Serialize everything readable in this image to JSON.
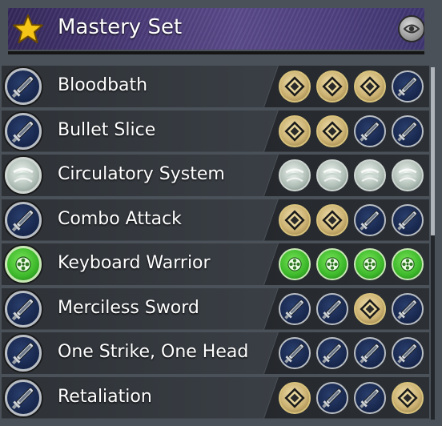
{
  "header": {
    "title": "Mastery Set",
    "icon": "star-icon",
    "toggle_icon": "eye-icon"
  },
  "colors": {
    "gold": "#cdb374",
    "blade_blue": "#1f3260",
    "green": "#3cb82a"
  },
  "rows": [
    {
      "label": "Bloodbath",
      "icon": "blade",
      "slots": [
        "gold",
        "gold",
        "gold",
        "blade"
      ]
    },
    {
      "label": "Bullet Slice",
      "icon": "blade",
      "slots": [
        "gold",
        "gold",
        "blade",
        "blade"
      ]
    },
    {
      "label": "Circulatory System",
      "icon": "silver",
      "slots": [
        "silver",
        "silver",
        "silver",
        "silver"
      ]
    },
    {
      "label": "Combo Attack",
      "icon": "blade",
      "slots": [
        "gold",
        "gold",
        "blade",
        "blade"
      ]
    },
    {
      "label": "Keyboard Warrior",
      "icon": "green",
      "slots": [
        "green",
        "green",
        "green",
        "green"
      ]
    },
    {
      "label": "Merciless Sword",
      "icon": "blade",
      "slots": [
        "blade",
        "blade",
        "gold",
        "blade"
      ]
    },
    {
      "label": "One Strike, One Head",
      "icon": "blade",
      "slots": [
        "blade",
        "blade",
        "blade",
        "blade"
      ]
    },
    {
      "label": "Retaliation",
      "icon": "blade",
      "slots": [
        "gold",
        "blade",
        "blade",
        "gold"
      ]
    }
  ]
}
